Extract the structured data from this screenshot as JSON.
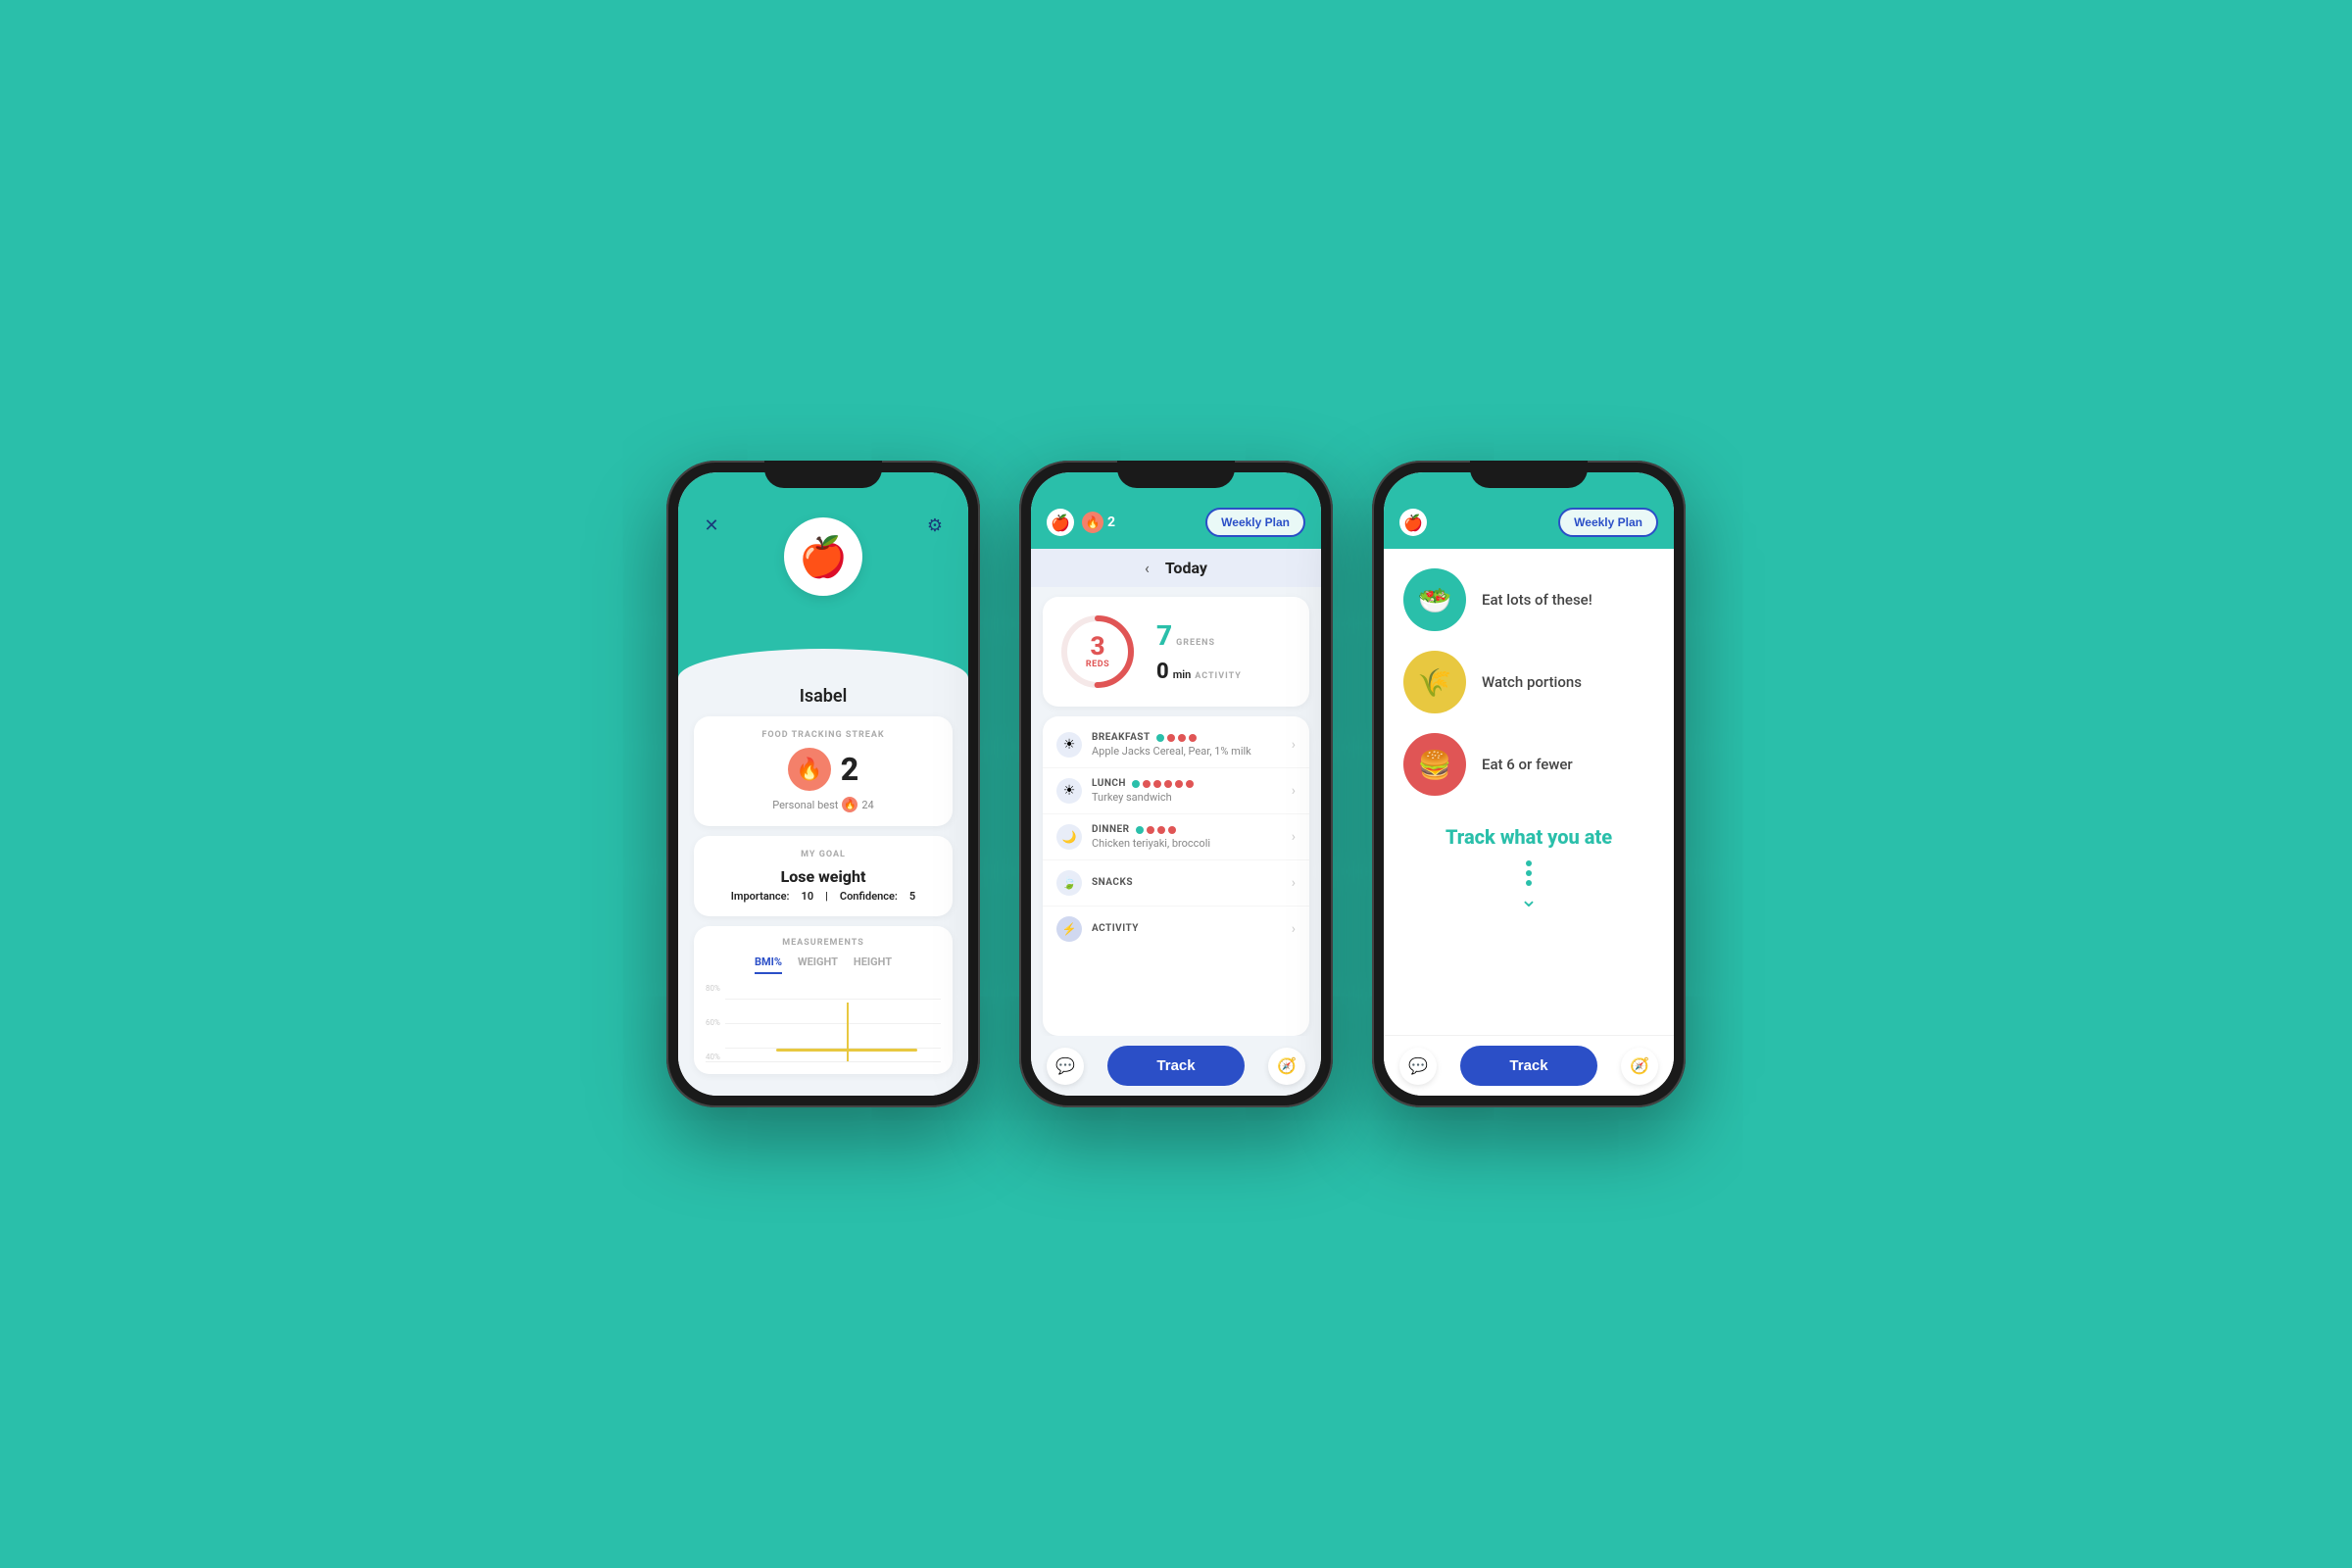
{
  "background_color": "#2abfaa",
  "phone1": {
    "user_name": "Isabel",
    "close_icon": "✕",
    "settings_icon": "⚙",
    "apple_emoji": "🍎",
    "streak_section": {
      "label": "FOOD TRACKING STREAK",
      "value": "2",
      "fire_emoji": "🔥",
      "personal_best_label": "Personal best",
      "personal_best_value": "24"
    },
    "goal_section": {
      "label": "MY GOAL",
      "goal": "Lose weight",
      "importance_label": "Importance:",
      "importance_value": "10",
      "confidence_label": "Confidence:",
      "confidence_value": "5"
    },
    "measurements_section": {
      "label": "MEASUREMENTS",
      "tabs": [
        "BMI%",
        "WEIGHT",
        "HEIGHT"
      ],
      "active_tab": "BMI%",
      "chart_labels": [
        "80%",
        "60%",
        "40%"
      ]
    }
  },
  "phone2": {
    "apple_emoji": "🍎",
    "fire_emoji": "🔥",
    "streak_value": "2",
    "weekly_plan_label": "Weekly Plan",
    "today_label": "Today",
    "reds_value": "3",
    "reds_label": "REDS",
    "greens_value": "7",
    "greens_label": "GREENS",
    "activity_value": "0",
    "activity_unit": "min",
    "activity_label": "ACTIVITY",
    "meals": [
      {
        "name": "BREAKFAST",
        "foods": "Apple Jacks Cereal, Pear, 1% milk",
        "icon": "☀",
        "dots": [
          "green",
          "red",
          "red",
          "red"
        ]
      },
      {
        "name": "LUNCH",
        "foods": "Turkey sandwich",
        "icon": "☀",
        "dots": [
          "green",
          "red",
          "red",
          "red",
          "red",
          "red"
        ]
      },
      {
        "name": "DINNER",
        "foods": "Chicken teriyaki, broccoli",
        "icon": "🌙",
        "dots": [
          "green",
          "red",
          "red",
          "red"
        ]
      },
      {
        "name": "SNACKS",
        "foods": "",
        "icon": "🍃",
        "dots": []
      },
      {
        "name": "ACTIVITY",
        "foods": "",
        "icon": "⚡",
        "dots": []
      }
    ],
    "track_label": "Track",
    "chat_icon": "💬",
    "compass_icon": "🧭"
  },
  "phone3": {
    "apple_emoji": "🍎",
    "weekly_plan_label": "Weekly Plan",
    "categories": [
      {
        "label": "Eat lots of these!",
        "color_class": "circle-green",
        "emoji": "🥗"
      },
      {
        "label": "Watch portions",
        "color_class": "circle-yellow",
        "emoji": "🌾"
      },
      {
        "label": "Eat 6 or fewer",
        "color_class": "circle-red",
        "emoji": "🍔"
      }
    ],
    "track_cta": "Track what you ate",
    "track_label": "Track",
    "chat_icon": "💬",
    "compass_icon": "🧭"
  }
}
